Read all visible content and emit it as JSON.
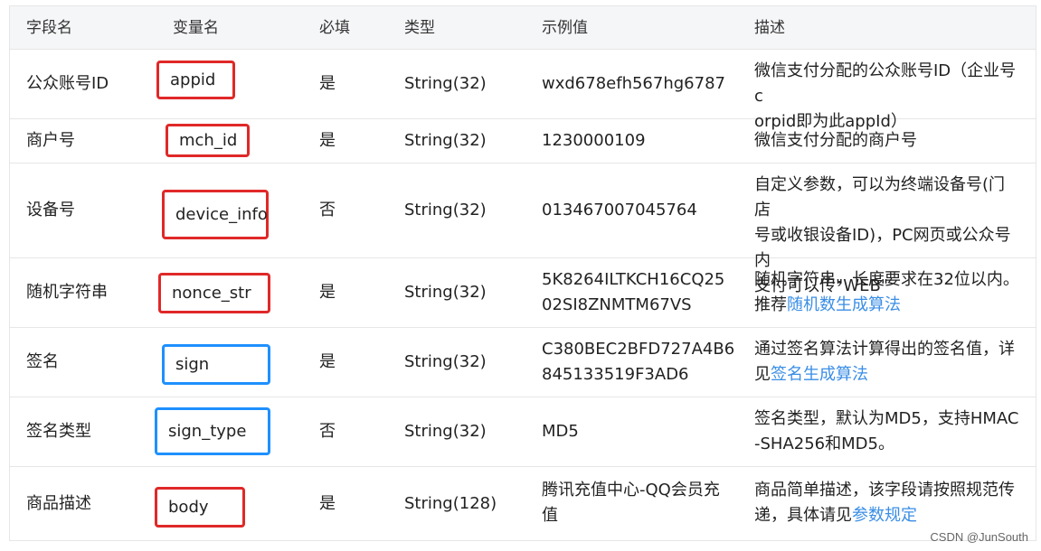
{
  "header": [
    "字段名",
    "变量名",
    "必填",
    "类型",
    "示例值",
    "描述"
  ],
  "rows": [
    {
      "field": "公众账号ID",
      "variable": "appid",
      "required": "是",
      "type": "String(32)",
      "example": "wxd678efh567hg6787",
      "description_lines": [
        "微信支付分配的公众账号ID（企业号c",
        "orpid即为此appId）"
      ],
      "box_color": "red"
    },
    {
      "field": "商户号",
      "variable": "mch_id",
      "required": "是",
      "type": "String(32)",
      "example": "1230000109",
      "description_lines": [
        "微信支付分配的商户号"
      ],
      "box_color": "red"
    },
    {
      "field": "设备号",
      "variable": "device_info",
      "required": "否",
      "type": "String(32)",
      "example": "013467007045764",
      "description_lines": [
        "自定义参数，可以为终端设备号(门店",
        "号或收银设备ID)，PC网页或公众号内",
        "支付可以传\"WEB\""
      ],
      "box_color": "red"
    },
    {
      "field": "随机字符串",
      "variable": "nonce_str",
      "required": "是",
      "type": "String(32)",
      "example_lines": [
        "5K8264ILTKCH16CQ25",
        "02SI8ZNMTM67VS"
      ],
      "description_lines": [
        "随机字符串，长度要求在32位以内。"
      ],
      "description_prefix": "推荐",
      "description_link": "随机数生成算法",
      "box_color": "red"
    },
    {
      "field": "签名",
      "variable": "sign",
      "required": "是",
      "type": "String(32)",
      "example_lines": [
        "C380BEC2BFD727A4B6",
        "845133519F3AD6"
      ],
      "description_lines": [
        "通过签名算法计算得出的签名值，详"
      ],
      "description_prefix": "见",
      "description_link": "签名生成算法",
      "box_color": "blue"
    },
    {
      "field": "签名类型",
      "variable": "sign_type",
      "required": "否",
      "type": "String(32)",
      "example": "MD5",
      "description_lines": [
        "签名类型，默认为MD5，支持HMAC",
        "-SHA256和MD5。"
      ],
      "box_color": "blue"
    },
    {
      "field": "商品描述",
      "variable": "body",
      "required": "是",
      "type": "String(128)",
      "example_lines": [
        "腾讯充值中心-QQ会员充",
        "值"
      ],
      "description_lines": [
        "商品简单描述，该字段请按照规范传"
      ],
      "description_prefix": "递，具体请见",
      "description_link": "参数规定",
      "box_color": "red"
    }
  ],
  "watermark": "CSDN @JunSouth",
  "colors": {
    "red_box": "#e02828",
    "blue_box": "#1e90ff",
    "link": "#3a8ee6",
    "header_bg": "#f5f6f8"
  }
}
